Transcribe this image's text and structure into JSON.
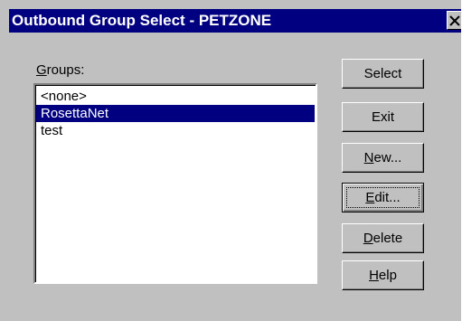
{
  "window": {
    "title": "Outbound Group Select - PETZONE",
    "close_label": "X"
  },
  "groups": {
    "label_mnemonic": "G",
    "label_rest": "roups:",
    "items": [
      {
        "label": "<none>",
        "selected": false
      },
      {
        "label": "RosettaNet",
        "selected": true
      },
      {
        "label": "test",
        "selected": false
      }
    ]
  },
  "buttons": {
    "select": {
      "label": "Select"
    },
    "exit": {
      "label": "Exit"
    },
    "new": {
      "mnemonic": "N",
      "rest": "ew..."
    },
    "edit": {
      "mnemonic": "E",
      "rest": "dit...",
      "focused": true
    },
    "delete": {
      "mnemonic": "D",
      "rest": "elete"
    },
    "help": {
      "mnemonic": "H",
      "rest": "elp"
    }
  },
  "colors": {
    "titlebar": "#000080",
    "selection": "#000080",
    "face": "#c0c0c0"
  }
}
